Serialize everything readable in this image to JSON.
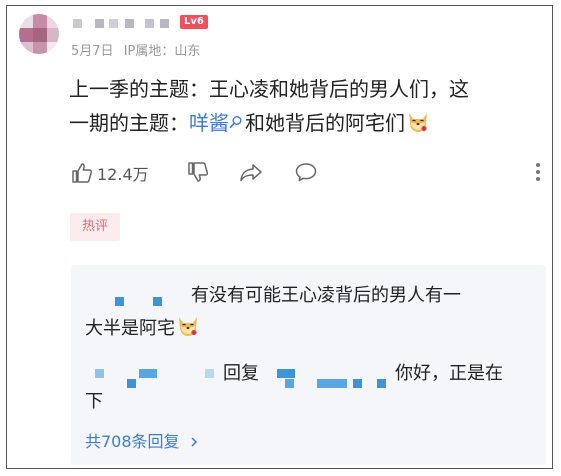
{
  "comment": {
    "meta_date": "5月7日",
    "meta_ip": "IP属地：山东",
    "level_badge": "Lv6",
    "content_line1": "上一季的主题：王心凌和她背后的男人们，这",
    "content_line2_prefix": "一期的主题：",
    "content_link": "咩酱",
    "content_line2_suffix": "和她背后的阿宅们",
    "likes": "12.4万",
    "hot_badge": "热评"
  },
  "replies": {
    "reply1_line1": "有没有可能王心凌背后的男人有一",
    "reply1_line2": "大半是阿宅",
    "reply2_word": "回复",
    "reply2_tail": "你好，正是在",
    "reply2_line2": "下",
    "more_label": "共708条回复"
  },
  "icons": [
    "like-icon",
    "dislike-icon",
    "share-icon",
    "comment-icon",
    "more-icon",
    "search-icon",
    "dog-emoji-icon",
    "chevron-right-icon"
  ],
  "colors": {
    "link": "#3c7ad9",
    "hot_badge_bg": "#fdeced",
    "hot_badge_text": "#e7686e",
    "level_bg": "#ee5060"
  }
}
